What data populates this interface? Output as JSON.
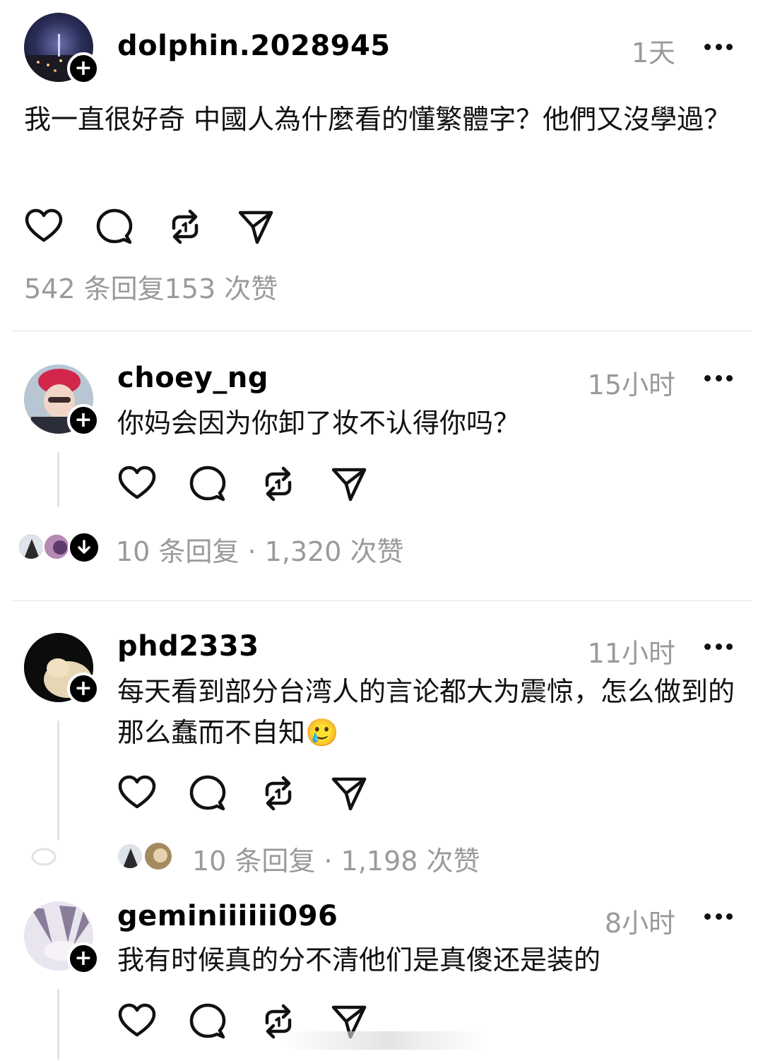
{
  "post": {
    "username": "dolphin.2028945",
    "time": "1天",
    "text": "我一直很好奇  中國人為什麼看的懂繁體字？他們又沒學過？",
    "stats": "542 条回复153 次赞"
  },
  "replies": [
    {
      "username": "choey_ng",
      "time": "15小时",
      "text": "你妈会因为你卸了妆不认得你吗？",
      "stats": "10 条回复 · 1,320 次赞"
    },
    {
      "username": "phd2333",
      "time": "11小时",
      "text": "每天看到部分台湾人的言论都大为震惊，怎么做到的那么蠢而不自知",
      "emoji": "🥲",
      "stats": "10 条回复 · 1,198 次赞"
    },
    {
      "username": "geminiiiiii096",
      "time": "8小时",
      "text": "我有时候真的分不清他们是真傻还是装的"
    }
  ],
  "icons": {
    "like": "heart-icon",
    "comment": "comment-bubble-icon",
    "repost": "repost-icon",
    "share": "send-icon",
    "more": "more-dots-icon",
    "follow": "plus-icon"
  }
}
